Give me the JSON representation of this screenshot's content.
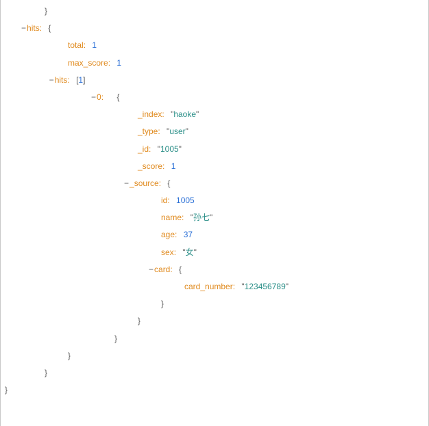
{
  "tree": {
    "close_top": "}",
    "hits_key": "hits",
    "total_key": "total",
    "total_val": "1",
    "max_score_key": "max_score",
    "max_score_val": "1",
    "hits_arr_key": "hits",
    "hits_arr_len": "1",
    "item0_key": "0",
    "index_key": "_index",
    "index_val": "haoke",
    "type_key": "_type",
    "type_val": "user",
    "id_key": "_id",
    "id_val": "1005",
    "score_key": "_score",
    "score_val": "1",
    "source_key": "_source",
    "src_id_key": "id",
    "src_id_val": "1005",
    "src_name_key": "name",
    "src_name_val": "孙七",
    "src_age_key": "age",
    "src_age_val": "37",
    "src_sex_key": "sex",
    "src_sex_val": "女",
    "card_key": "card",
    "card_number_key": "card_number",
    "card_number_val": "123456789"
  },
  "glyph": {
    "toggle_minus": "−",
    "brace_open": "{",
    "brace_close": "}",
    "bracket_open": "[",
    "bracket_close": "]",
    "quote": "\""
  }
}
